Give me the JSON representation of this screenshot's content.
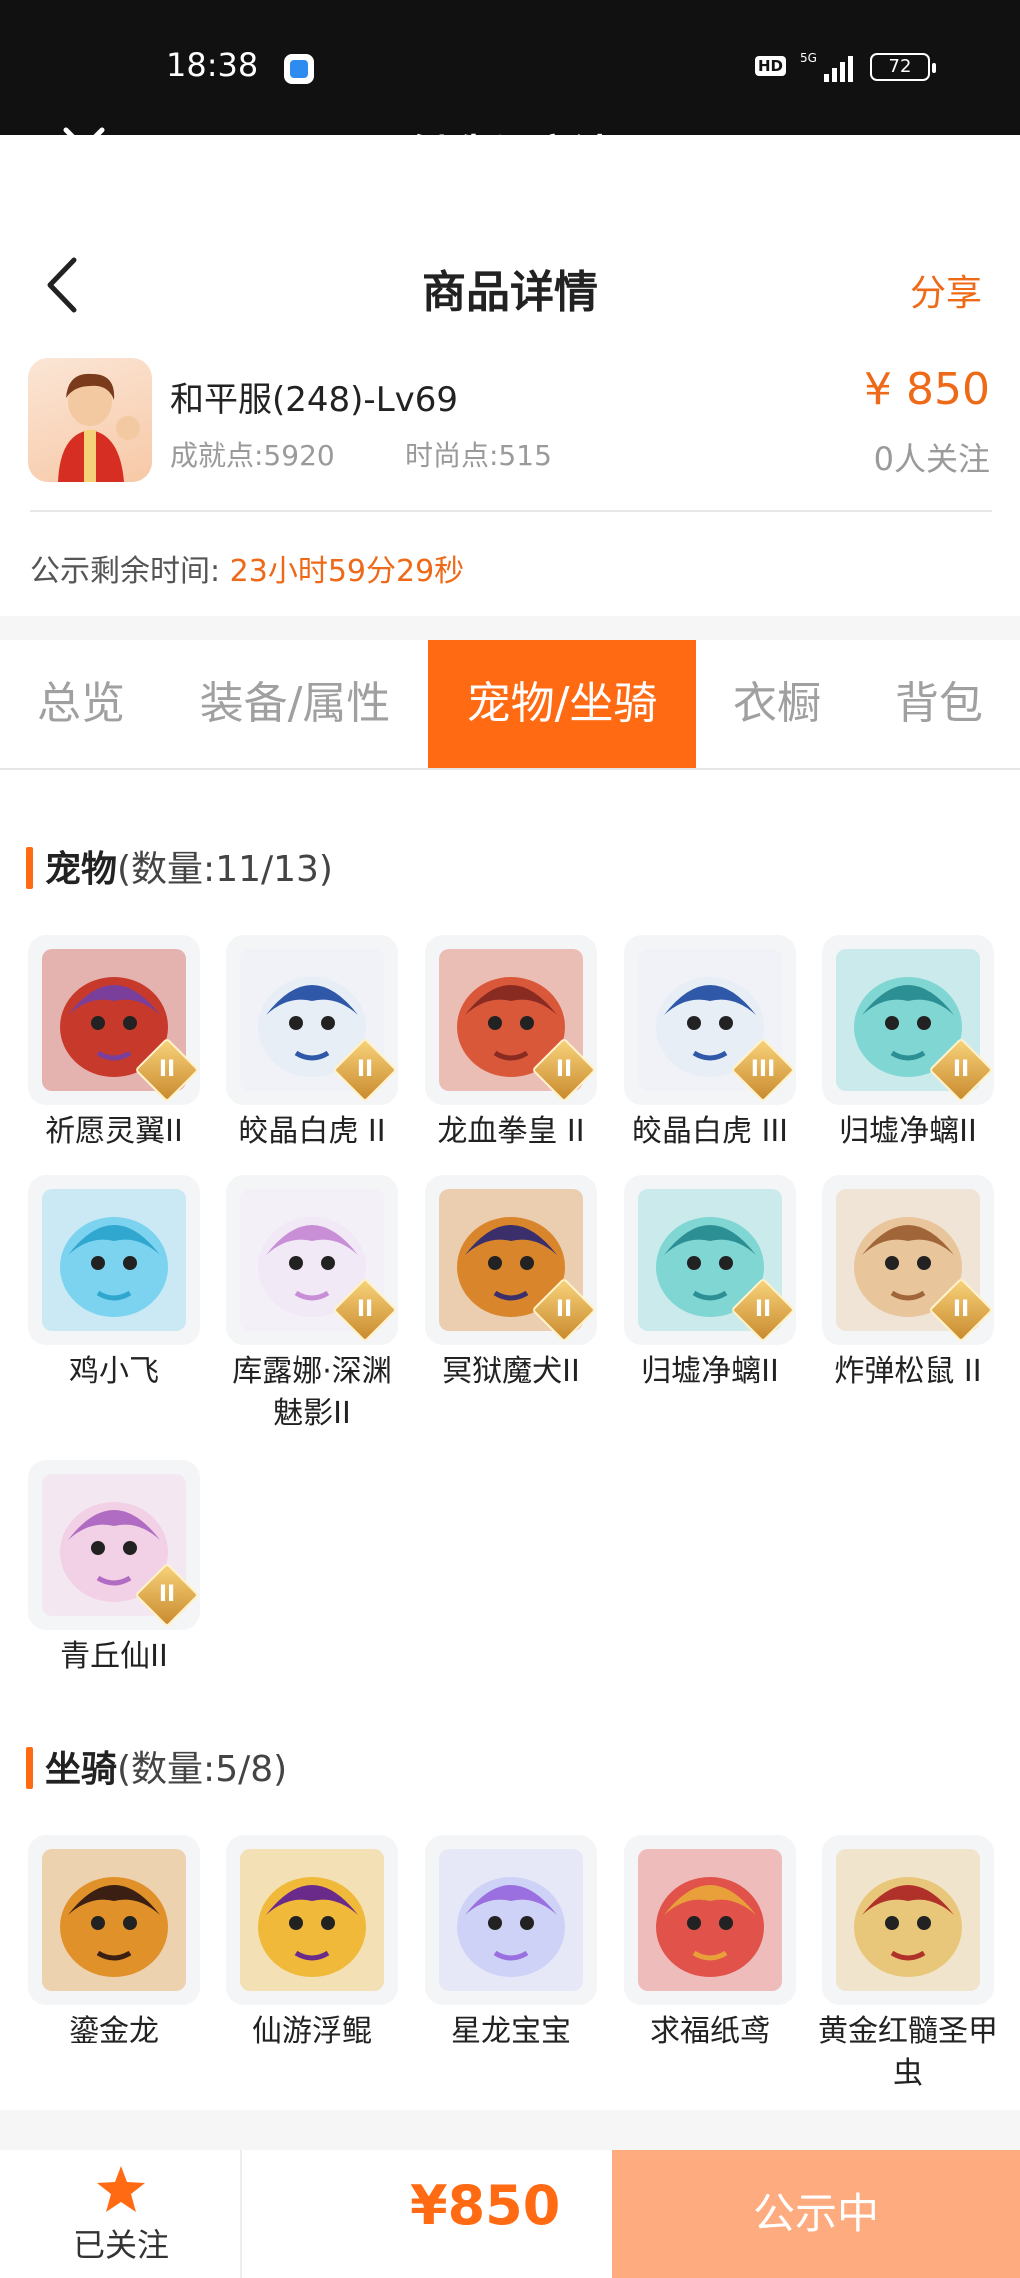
{
  "status_bar": {
    "time": "18:38",
    "hd": "HD",
    "network": "5G",
    "battery": "72"
  },
  "app": {
    "title": "创造与魔法"
  },
  "header": {
    "title": "商品详情",
    "share_label": "分享"
  },
  "product": {
    "name": "和平服(248)-Lv69",
    "achievement": "成就点:5920",
    "fashion": "时尚点:515",
    "price": "¥ 850",
    "followers": "0人关注"
  },
  "countdown": {
    "label": "公示剩余时间:",
    "value": "23小时59分29秒"
  },
  "tabs": [
    {
      "label": "总览",
      "active": false
    },
    {
      "label": "装备/属性",
      "active": false
    },
    {
      "label": "宠物/坐骑",
      "active": true
    },
    {
      "label": "衣橱",
      "active": false
    },
    {
      "label": "背包",
      "active": false
    }
  ],
  "pets": {
    "title": "宠物",
    "count": "(数量:11/13)",
    "items": [
      {
        "name": "祈愿灵翼II",
        "badge": "II",
        "colors": [
          "#c73a2b",
          "#7a3f9a"
        ]
      },
      {
        "name": "皎晶白虎 II",
        "badge": "II",
        "colors": [
          "#e8eef6",
          "#2f58a8"
        ]
      },
      {
        "name": "龙血拳皇 II",
        "badge": "II",
        "colors": [
          "#d9583a",
          "#8a2b22"
        ]
      },
      {
        "name": "皎晶白虎 III",
        "badge": "III",
        "colors": [
          "#e8eef6",
          "#2f58a8"
        ]
      },
      {
        "name": "归墟净螭II",
        "badge": "II",
        "colors": [
          "#7fd6d3",
          "#2c8f94"
        ]
      },
      {
        "name": "鸡小飞",
        "badge": "",
        "colors": [
          "#7cd3ef",
          "#2fa7cf"
        ]
      },
      {
        "name": "库露娜·深渊魅影II",
        "badge": "II",
        "colors": [
          "#f1e9f6",
          "#c88fd6"
        ]
      },
      {
        "name": "冥狱魔犬II",
        "badge": "II",
        "colors": [
          "#d9852b",
          "#3b2f6b"
        ]
      },
      {
        "name": "归墟净螭II",
        "badge": "II",
        "colors": [
          "#7fd6d3",
          "#2c8f94"
        ]
      },
      {
        "name": "炸弹松鼠 II",
        "badge": "II",
        "colors": [
          "#e8c59a",
          "#a0663a"
        ]
      },
      {
        "name": "青丘仙II",
        "badge": "II",
        "colors": [
          "#f2d0e6",
          "#b06cc2"
        ]
      }
    ]
  },
  "mounts": {
    "title": "坐骑",
    "count": "(数量:5/8)",
    "items": [
      {
        "name": "鎏金龙",
        "badge": "",
        "colors": [
          "#e0912a",
          "#3b1f12"
        ]
      },
      {
        "name": "仙游浮鲲",
        "badge": "",
        "colors": [
          "#f0b93a",
          "#6a2a8a"
        ]
      },
      {
        "name": "星龙宝宝",
        "badge": "",
        "colors": [
          "#cfd2f7",
          "#9a6fe0"
        ]
      },
      {
        "name": "求福纸鸢",
        "badge": "",
        "colors": [
          "#e0524a",
          "#e9a03a"
        ]
      },
      {
        "name": "黄金红髓圣甲虫",
        "badge": "",
        "colors": [
          "#e9c77a",
          "#b0302a"
        ]
      }
    ]
  },
  "bottom": {
    "follow_label": "已关注",
    "price": "¥850",
    "status_label": "公示中"
  },
  "colors": {
    "accent": "#ff6a13",
    "status_button": "#ffab80",
    "price_text": "#ee6a18"
  }
}
